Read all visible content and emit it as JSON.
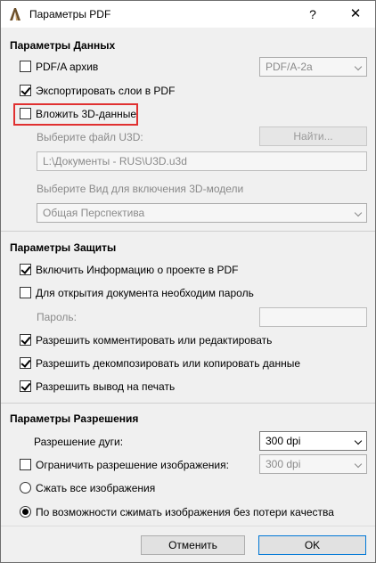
{
  "window": {
    "title": "Параметры PDF",
    "help": "?",
    "close": "✕"
  },
  "data_params": {
    "title": "Параметры Данных",
    "pdfa": {
      "label": "PDF/A архив",
      "checked": false,
      "combo_value": "PDF/A-2a"
    },
    "export_layers": {
      "label": "Экспортировать слои в PDF",
      "checked": true
    },
    "embed_3d": {
      "label": "Вложить 3D-данные",
      "checked": false
    },
    "u3d_label": "Выберите файл U3D:",
    "find_button": "Найти...",
    "u3d_path": "L:\\Документы - RUS\\U3D.u3d",
    "view_label": "Выберите Вид для включения 3D-модели",
    "view_value": "Общая Перспектива"
  },
  "security_params": {
    "title": "Параметры Защиты",
    "include_info": {
      "label": "Включить Информацию о проекте в PDF",
      "checked": true
    },
    "require_password": {
      "label": "Для открытия документа необходим пароль",
      "checked": false
    },
    "password_label": "Пароль:",
    "allow_comment": {
      "label": "Разрешить комментировать или редактировать",
      "checked": true
    },
    "allow_decompose": {
      "label": "Разрешить декомпозировать или копировать данные",
      "checked": true
    },
    "allow_print": {
      "label": "Разрешить вывод на печать",
      "checked": true
    }
  },
  "resolution_params": {
    "title": "Параметры Разрешения",
    "arc_label": "Разрешение дуги:",
    "arc_value": "300 dpi",
    "limit_images": {
      "label": "Ограничить разрешение изображения:",
      "checked": false,
      "value": "300 dpi"
    },
    "compress_all": {
      "label": "Сжать все изображения",
      "selected": false
    },
    "compress_lossless": {
      "label": "По возможности сжимать изображения без потери качества",
      "selected": true
    }
  },
  "footer": {
    "cancel": "Отменить",
    "ok": "OK"
  }
}
